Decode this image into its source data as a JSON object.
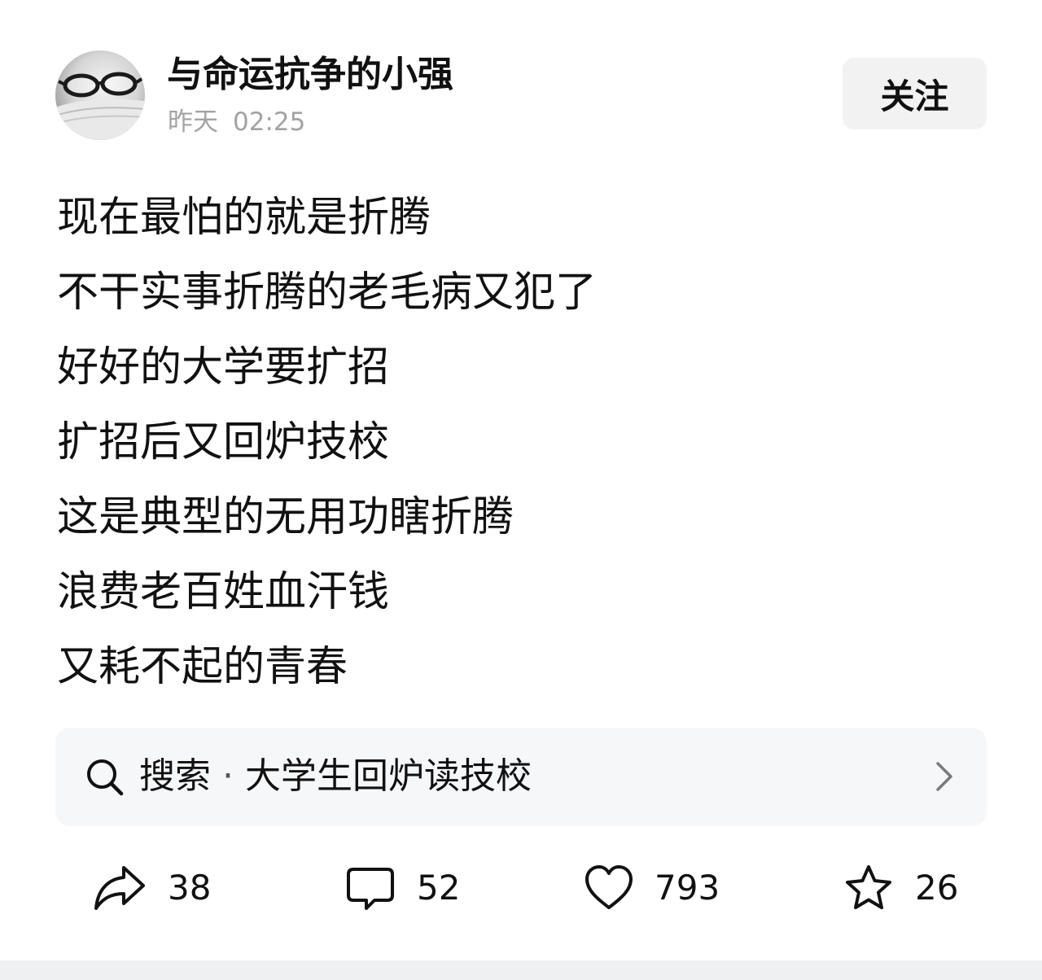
{
  "author": {
    "name": "与命运抗争的小强",
    "time_day": "昨天",
    "time_clock": "02:25",
    "avatar_icon": "glasses-on-book-avatar"
  },
  "follow_label": "关注",
  "content_lines": [
    "现在最怕的就是折腾",
    "不干实事折腾的老毛病又犯了",
    "好好的大学要扩招",
    "扩招后又回炉技校",
    "这是典型的无用功瞎折腾",
    "浪费老百姓血汗钱",
    "又耗不起的青春"
  ],
  "search": {
    "prefix": "搜索",
    "separator": "·",
    "query": "大学生回炉读技校",
    "icon": "search-icon",
    "arrow_icon": "chevron-right-icon"
  },
  "actions": {
    "share": {
      "count": "38",
      "icon": "share-icon"
    },
    "comment": {
      "count": "52",
      "icon": "comment-icon"
    },
    "like": {
      "count": "793",
      "icon": "heart-icon"
    },
    "favorite": {
      "count": "26",
      "icon": "star-icon"
    }
  },
  "colors": {
    "text": "#111111",
    "muted": "#a3a3a3",
    "button_bg": "#f2f2f2",
    "search_bg": "#f6f7f9"
  }
}
